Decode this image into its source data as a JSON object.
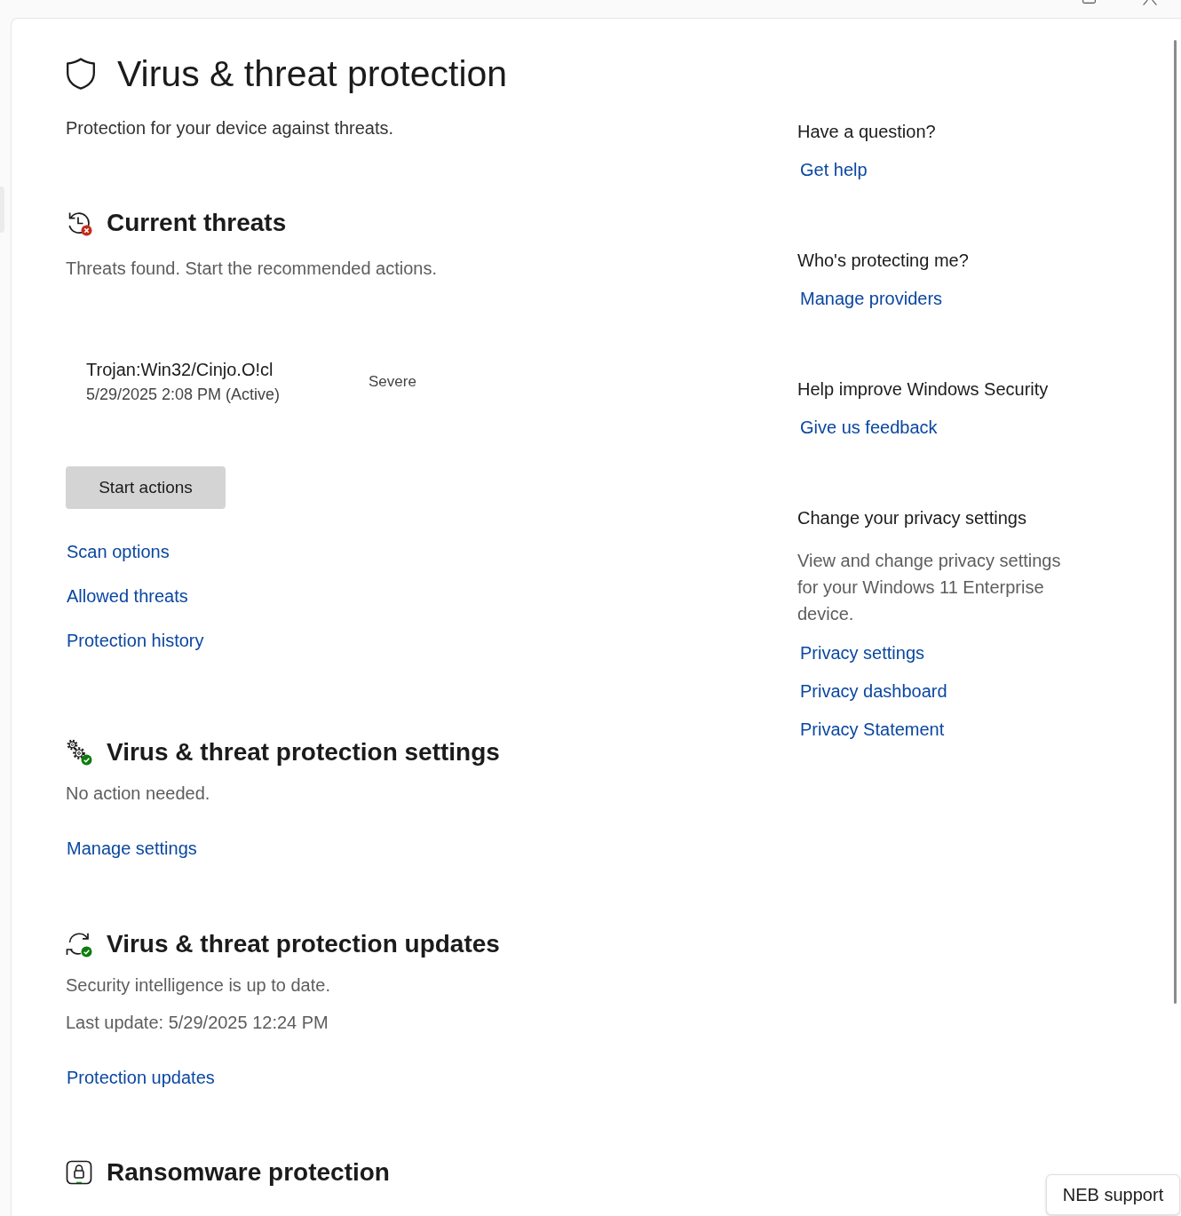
{
  "header": {
    "title": "Virus & threat protection",
    "subtitle": "Protection for your device against threats."
  },
  "sections": [
    {
      "kind": "threats",
      "title": "Current threats",
      "lines": [
        "Threats found. Start the recommended actions."
      ],
      "threats": [
        {
          "name": "Trojan:Win32/Cinjo.O!cl",
          "detected": "5/29/2025 2:08 PM (Active)",
          "severity": "Severe"
        }
      ],
      "button": "Start actions",
      "links": [
        "Scan options",
        "Allowed threats",
        "Protection history"
      ]
    },
    {
      "kind": "settings",
      "title": "Virus & threat protection settings",
      "lines": [
        "No action needed."
      ],
      "links": [
        "Manage settings"
      ]
    },
    {
      "kind": "updates",
      "title": "Virus & threat protection updates",
      "lines": [
        "Security intelligence is up to date.",
        "Last update: 5/29/2025 12:24 PM"
      ],
      "links": [
        "Protection updates"
      ]
    },
    {
      "kind": "ransomware",
      "title": "Ransomware protection"
    }
  ],
  "help_panel": [
    {
      "heading": "Have a question?",
      "links": [
        "Get help"
      ]
    },
    {
      "heading": "Who's protecting me?",
      "links": [
        "Manage providers"
      ]
    },
    {
      "heading": "Help improve Windows Security",
      "links": [
        "Give us feedback"
      ]
    },
    {
      "heading": "Change your privacy settings",
      "description": "View and change privacy settings for your Windows 11 Enterprise device.",
      "links": [
        "Privacy settings",
        "Privacy dashboard",
        "Privacy Statement"
      ]
    }
  ],
  "support_button": "NEB support"
}
